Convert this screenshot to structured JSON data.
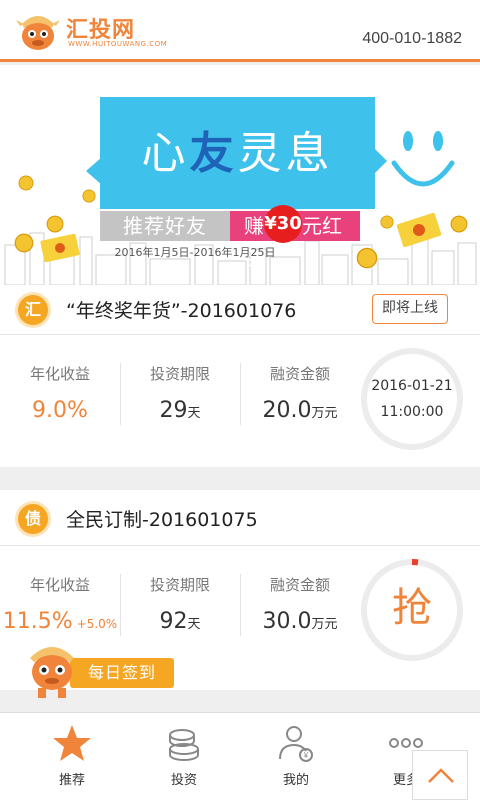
{
  "header": {
    "logo_text": "汇投网",
    "logo_sub": "WWW.HUITOUWANG.COM",
    "phone": "400-010-1882"
  },
  "banner": {
    "title_pre": "心",
    "title_hl": "友",
    "title_post": "灵息",
    "ribbon_left": "推荐好友",
    "ribbon_earn": "赚",
    "ribbon_amount": "¥30",
    "ribbon_right_tail": "元红包",
    "date_range": "2016年1月5日-2016年1月25日"
  },
  "products": [
    {
      "badge": "汇",
      "title": "“年终奖年货”-201601076",
      "status": "即将上线",
      "rate_label": "年化收益",
      "rate": "9.0%",
      "rate_extra": "",
      "term_label": "投资期限",
      "term": "29",
      "term_unit": "天",
      "amount_label": "融资金额",
      "amount": "20.0",
      "amount_unit": "万元",
      "date": "2016-01-21",
      "time": "11:00:00"
    },
    {
      "badge": "债",
      "title": "全民订制-201601075",
      "status": "",
      "rate_label": "年化收益",
      "rate": "11.5%",
      "rate_extra": "+5.0%",
      "term_label": "投资期限",
      "term": "92",
      "term_unit": "天",
      "amount_label": "融资金额",
      "amount": "30.0",
      "amount_unit": "万元",
      "action": "抢"
    }
  ],
  "checkin": {
    "label": "每日签到"
  },
  "nav": {
    "items": [
      {
        "label": "推荐",
        "icon": "star-icon"
      },
      {
        "label": "投资",
        "icon": "coins-icon"
      },
      {
        "label": "我的",
        "icon": "user-icon"
      },
      {
        "label": "更多",
        "icon": "more-icon"
      }
    ]
  },
  "colors": {
    "accent": "#f0843a",
    "badge": "#f5a623",
    "banner_blue": "#3ec1ea",
    "pink": "#e8417b"
  }
}
